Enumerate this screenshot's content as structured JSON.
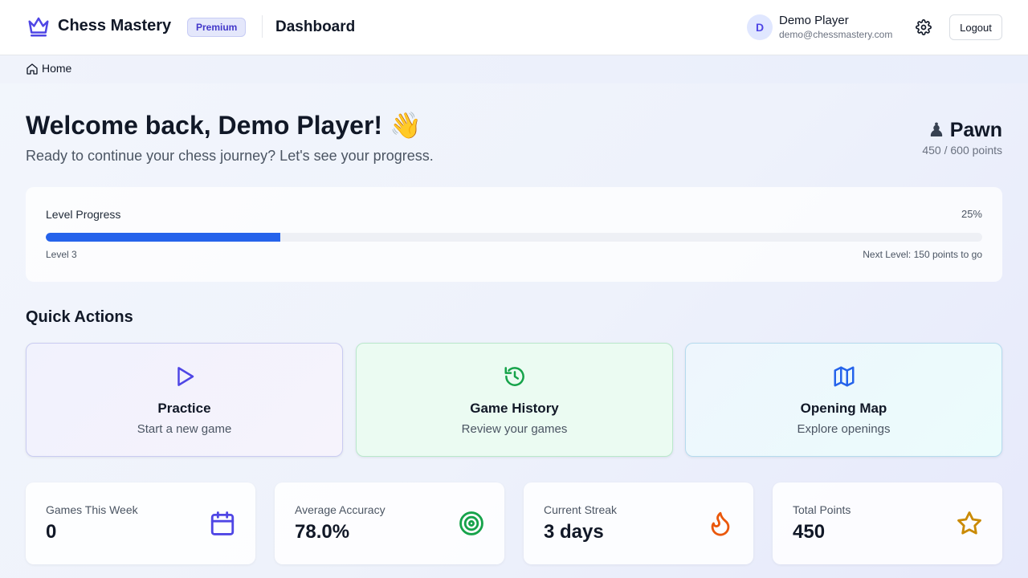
{
  "header": {
    "app_title": "Chess Mastery",
    "badge": "Premium",
    "page_title": "Dashboard",
    "user": {
      "initial": "D",
      "name": "Demo Player",
      "email": "demo@chessmastery.com"
    },
    "logout_label": "Logout"
  },
  "breadcrumb": {
    "home_label": "Home"
  },
  "welcome": {
    "title": "Welcome back, Demo Player! 👋",
    "subtitle": "Ready to continue your chess journey? Let's see your progress."
  },
  "rank": {
    "icon": "♟",
    "name": "Pawn",
    "points": "450 / 600 points"
  },
  "progress": {
    "label": "Level Progress",
    "percent_text": "25%",
    "fraction": 0.25,
    "level": "Level 3",
    "next": "Next Level: 150 points to go"
  },
  "quick_actions": {
    "title": "Quick Actions",
    "items": [
      {
        "icon": "play-icon",
        "title": "Practice",
        "subtitle": "Start a new game",
        "color": "#4f46e5"
      },
      {
        "icon": "history-icon",
        "title": "Game History",
        "subtitle": "Review your games",
        "color": "#16a34a"
      },
      {
        "icon": "map-icon",
        "title": "Opening Map",
        "subtitle": "Explore openings",
        "color": "#2563eb"
      }
    ]
  },
  "stats": [
    {
      "label": "Games This Week",
      "value": "0",
      "icon": "calendar-icon",
      "color": "#4f46e5"
    },
    {
      "label": "Average Accuracy",
      "value": "78.0%",
      "icon": "target-icon",
      "color": "#16a34a"
    },
    {
      "label": "Current Streak",
      "value": "3 days",
      "icon": "flame-icon",
      "color": "#ea580c"
    },
    {
      "label": "Total Points",
      "value": "450",
      "icon": "star-icon",
      "color": "#ca8a04"
    }
  ]
}
